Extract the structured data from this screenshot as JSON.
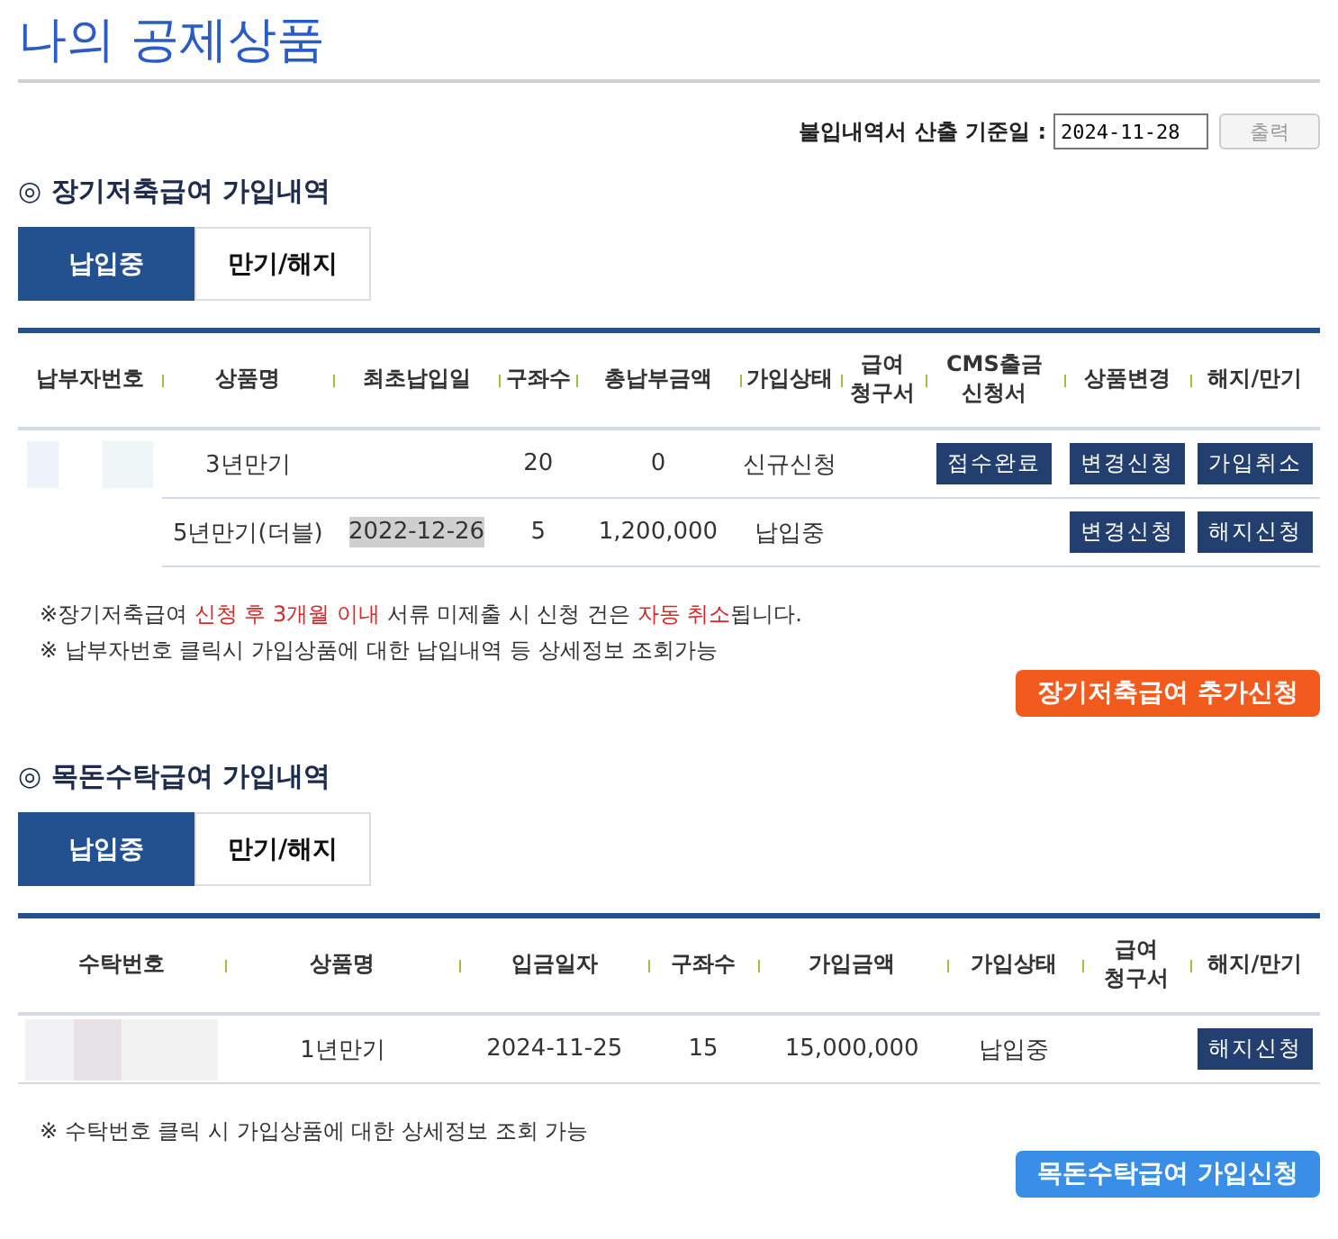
{
  "title": "나의 공제상품",
  "report": {
    "label": "불입내역서 산출 기준일 :",
    "date": "2024-11-28",
    "button": "출력"
  },
  "sections": [
    {
      "heading": "◎ 장기저축급여 가입내역",
      "tabs": [
        {
          "label": "납입중",
          "selected": true
        },
        {
          "label": "만기/해지",
          "selected": false
        }
      ],
      "columns": [
        {
          "label": "납부자번호"
        },
        {
          "label": "상품명"
        },
        {
          "label": "최초납입일"
        },
        {
          "label": "구좌수"
        },
        {
          "label": "총납부금액"
        },
        {
          "label": "가입상태"
        },
        {
          "label": "급여\n청구서"
        },
        {
          "label": "CMS출금\n신청서"
        },
        {
          "label": "상품변경"
        },
        {
          "label": "해지/만기"
        }
      ],
      "rows": [
        {
          "cells": [
            {
              "kind": "masked"
            },
            {
              "kind": "text",
              "text": "3년만기"
            },
            {
              "kind": "blank"
            },
            {
              "kind": "text",
              "text": "20"
            },
            {
              "kind": "text",
              "text": "0"
            },
            {
              "kind": "text",
              "text": "신규신청"
            },
            {
              "kind": "blank"
            },
            {
              "kind": "button",
              "text": "접수완료"
            },
            {
              "kind": "button",
              "text": "변경신청"
            },
            {
              "kind": "button",
              "text": "가입취소"
            }
          ]
        },
        {
          "cells": [
            {
              "kind": "blank"
            },
            {
              "kind": "text",
              "text": "5년만기(더블)"
            },
            {
              "kind": "text",
              "text": "2022-12-26",
              "highlighted": true
            },
            {
              "kind": "text",
              "text": "5"
            },
            {
              "kind": "text",
              "text": "1,200,000"
            },
            {
              "kind": "text",
              "text": "납입중"
            },
            {
              "kind": "blank"
            },
            {
              "kind": "blank"
            },
            {
              "kind": "button",
              "text": "변경신청"
            },
            {
              "kind": "button",
              "text": "해지신청"
            }
          ]
        }
      ],
      "notes": [
        [
          {
            "text": "※장기저축급여 ",
            "emphasis": false
          },
          {
            "text": "신청 후 3개월 이내",
            "emphasis": true
          },
          {
            "text": " 서류 미제출 시 신청 건은 ",
            "emphasis": false
          },
          {
            "text": "자동 취소",
            "emphasis": true
          },
          {
            "text": "됩니다.",
            "emphasis": false
          }
        ],
        [
          {
            "text": "※  납부자번호 클릭시 가입상품에 대한 납입내역 등 상세정보 조회가능",
            "emphasis": false
          }
        ]
      ],
      "action": {
        "label": "장기저축급여 추가신청",
        "color": "#f25a1e"
      }
    },
    {
      "heading": "◎ 목돈수탁급여 가입내역",
      "tabs": [
        {
          "label": "납입중",
          "selected": true
        },
        {
          "label": "만기/해지",
          "selected": false
        }
      ],
      "columns": [
        {
          "label": "수탁번호"
        },
        {
          "label": "상품명"
        },
        {
          "label": "입금일자"
        },
        {
          "label": "구좌수"
        },
        {
          "label": "가입금액"
        },
        {
          "label": "가입상태"
        },
        {
          "label": "급여\n청구서"
        },
        {
          "label": "해지/만기"
        }
      ],
      "rows": [
        {
          "cells": [
            {
              "kind": "masked"
            },
            {
              "kind": "text",
              "text": "1년만기"
            },
            {
              "kind": "text",
              "text": "2024-11-25",
              "highlighted": false
            },
            {
              "kind": "text",
              "text": "15"
            },
            {
              "kind": "text",
              "text": "15,000,000"
            },
            {
              "kind": "text",
              "text": "납입중"
            },
            {
              "kind": "blank"
            },
            {
              "kind": "button",
              "text": "해지신청"
            }
          ]
        }
      ],
      "notes": [
        [
          {
            "text": "※ 수탁번호 클릭 시 가입상품에 대한 상세정보 조회 가능",
            "emphasis": false
          }
        ]
      ],
      "action": {
        "label": "목돈수탁급여 가입신청",
        "color": "#3a8ee6"
      }
    }
  ]
}
